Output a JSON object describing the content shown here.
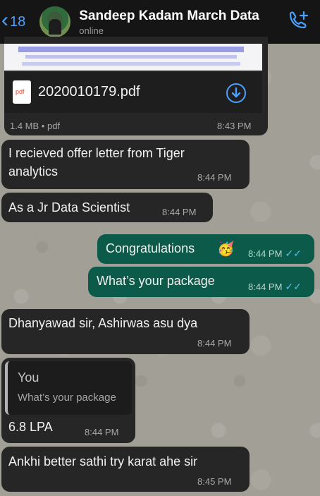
{
  "header": {
    "unread_count": "18",
    "contact_name": "Sandeep Kadam March Data",
    "status": "online"
  },
  "attachment": {
    "file_name": "2020010179.pdf",
    "file_icon_label": "pdf",
    "size_type": "1.4 MB • pdf",
    "time": "8:43 PM"
  },
  "messages": [
    {
      "text": "I recieved offer letter from Tiger",
      "text2": "analytics",
      "time": "8:44 PM"
    },
    {
      "text": "As a Jr Data Scientist",
      "time": "8:44 PM"
    },
    {
      "text": "Congratulations",
      "emoji": "🥳",
      "time": "8:44 PM"
    },
    {
      "text": "What’s your package",
      "time": "8:44 PM"
    },
    {
      "text": "Dhanyawad sir, Ashirwas asu dya",
      "time": "8:44 PM"
    },
    {
      "quote_author": "You",
      "quote_text": "What’s your package",
      "text": "6.8 LPA",
      "time": "8:44 PM"
    },
    {
      "text": "Ankhi better sathi try karat ahe sir",
      "time": "8:45 PM"
    }
  ],
  "colors": {
    "accent": "#4aa1ff",
    "outgoing_bubble": "#0c5a4a",
    "incoming_bubble": "#262626",
    "read_ticks": "#53bdeb"
  }
}
